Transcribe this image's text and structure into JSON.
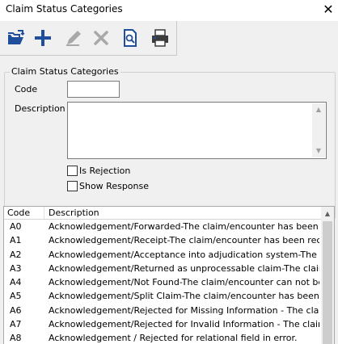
{
  "window": {
    "title": "Claim Status Categories",
    "close_glyph": "✕"
  },
  "toolbar": {
    "buttons": [
      {
        "icon": "open-folder-icon",
        "enabled": true
      },
      {
        "icon": "add-icon",
        "enabled": true
      },
      {
        "icon": "edit-icon",
        "enabled": false
      },
      {
        "icon": "delete-icon",
        "enabled": false
      },
      {
        "icon": "search-document-icon",
        "enabled": true
      },
      {
        "icon": "printer-icon",
        "enabled": true
      }
    ]
  },
  "form": {
    "group_title": "Claim Status Categories",
    "code_label": "Code",
    "code_value": "",
    "description_label": "Description",
    "description_value": "",
    "is_rejection_label": "Is Rejection",
    "is_rejection_checked": false,
    "show_response_label": "Show Response",
    "show_response_checked": false
  },
  "grid": {
    "columns": [
      "Code",
      "Description"
    ],
    "rows": [
      {
        "code": "A0",
        "description": "Acknowledgement/Forwarded-The claim/encounter has been forwarde"
      },
      {
        "code": "A1",
        "description": "Acknowledgement/Receipt-The claim/encounter has been received. T"
      },
      {
        "code": "A2",
        "description": "Acknowledgement/Acceptance into adjudication system-The claim/en"
      },
      {
        "code": "A3",
        "description": "Acknowledgement/Returned as unprocessable claim-The claim/encou"
      },
      {
        "code": "A4",
        "description": "Acknowledgement/Not Found-The claim/encounter can not be found"
      },
      {
        "code": "A5",
        "description": "Acknowledgement/Split Claim-The claim/encounter has been split upo"
      },
      {
        "code": "A6",
        "description": "Acknowledgement/Rejected for Missing Information - The claim/encou"
      },
      {
        "code": "A7",
        "description": "Acknowledgement/Rejected for Invalid Information - The claim/encour"
      },
      {
        "code": "A8",
        "description": "Acknowledgement / Rejected for relational field in error."
      }
    ]
  },
  "colors": {
    "accent_blue": "#1f4e9c",
    "disabled_gray": "#a8a8a8",
    "print_gray": "#3c3c3c"
  }
}
